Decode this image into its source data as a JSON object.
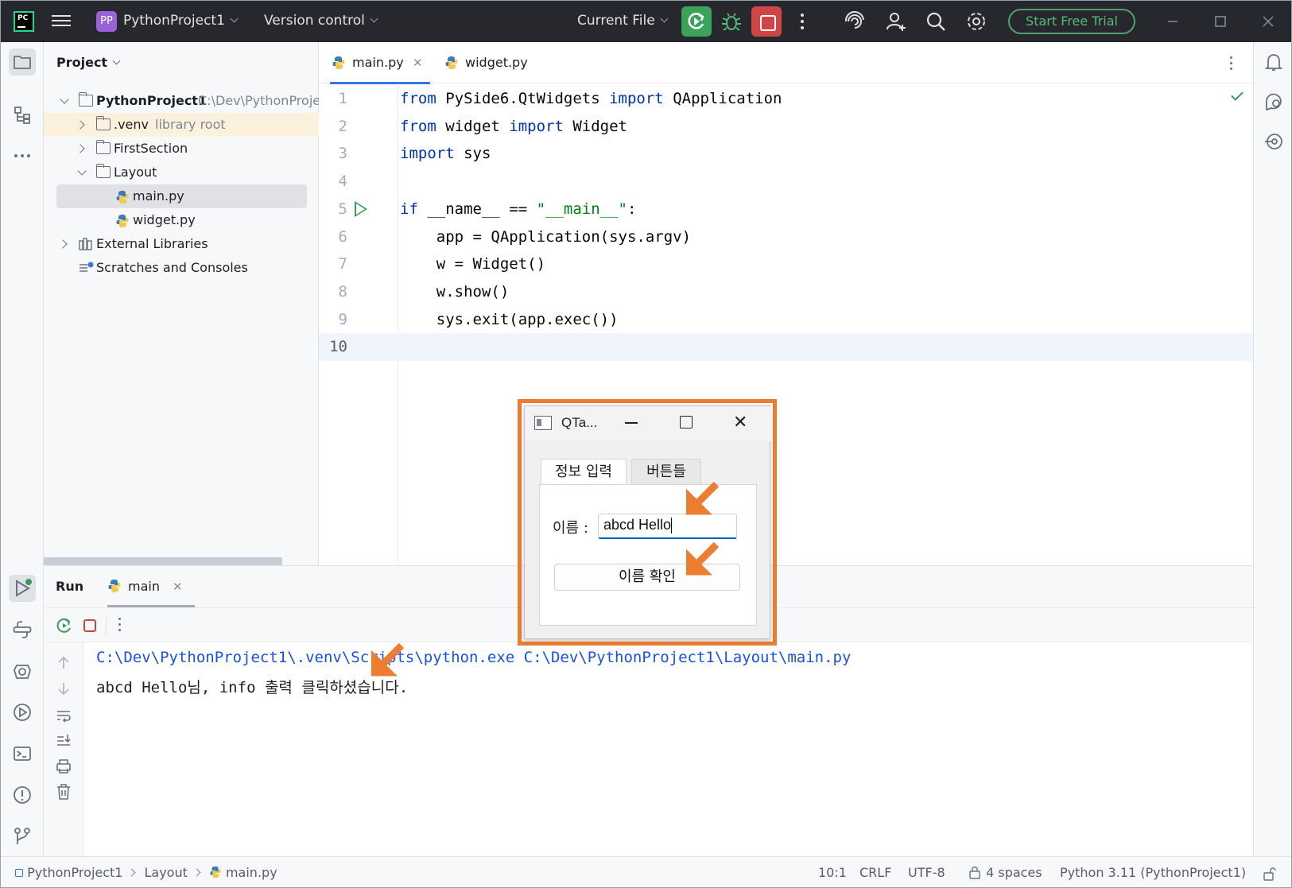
{
  "titlebar": {
    "project_badge": "PP",
    "project_name": "PythonProject1",
    "vcs": "Version control",
    "run_config": "Current File",
    "trial": "Start Free Trial"
  },
  "project_panel": {
    "title": "Project",
    "root_name": "PythonProject1",
    "root_path": "C:\\Dev\\PythonProje",
    "items": [
      {
        "label": "PythonProject1",
        "extra": "C:\\Dev\\PythonProje"
      },
      {
        "label": ".venv",
        "extra": "library root"
      },
      {
        "label": "FirstSection",
        "extra": ""
      },
      {
        "label": "Layout",
        "extra": ""
      },
      {
        "label": "main.py",
        "extra": ""
      },
      {
        "label": "widget.py",
        "extra": ""
      },
      {
        "label": "External Libraries",
        "extra": ""
      },
      {
        "label": "Scratches and Consoles",
        "extra": ""
      }
    ]
  },
  "editor": {
    "tabs": [
      {
        "label": "main.py"
      },
      {
        "label": "widget.py"
      }
    ],
    "line_numbers": [
      "1",
      "2",
      "3",
      "4",
      "5",
      "6",
      "7",
      "8",
      "9",
      "10"
    ],
    "lines": [
      {
        "t1": "from",
        "t2": " PySide6.QtWidgets ",
        "t3": "import",
        "t4": " QApplication"
      },
      {
        "t1": "from",
        "t2": " widget ",
        "t3": "import",
        "t4": " Widget"
      },
      {
        "t1": "import",
        "t2": " sys"
      },
      {},
      {
        "t1": "if",
        "t2": " __name__ == ",
        "t3": "\"__main__\"",
        "t4": ":"
      },
      {
        "t2": "    app = QApplication(sys.argv)"
      },
      {
        "t2": "    w = Widget()"
      },
      {
        "t2": "    w.show()"
      },
      {
        "t2": "    sys.exit(app.exec())"
      },
      {}
    ]
  },
  "run_panel": {
    "title": "Run",
    "tab": "main",
    "output": [
      "C:\\Dev\\PythonProject1\\.venv\\Scripts\\python.exe C:\\Dev\\PythonProject1\\Layout\\main.py",
      "abcd Hello님, info 출력 클릭하셨습니다."
    ]
  },
  "statusbar": {
    "crumbs": [
      "PythonProject1",
      "Layout",
      "main.py"
    ],
    "position": "10:1",
    "line_sep": "CRLF",
    "encoding": "UTF-8",
    "indent": "4 spaces",
    "interpreter": "Python 3.11 (PythonProject1)"
  },
  "qt_window": {
    "title": "QTa...",
    "tabs": [
      "정보 입력",
      "버튼들"
    ],
    "name_label": "이름 :",
    "name_value": "abcd Hello",
    "button_label": "이름 확인"
  },
  "colors": {
    "accent": "#3574f0",
    "run_green": "#39a35a",
    "stop_red": "#d04646",
    "callout_orange": "#ed7d31",
    "keyword_blue": "#0033b3",
    "string_green": "#067d17"
  }
}
